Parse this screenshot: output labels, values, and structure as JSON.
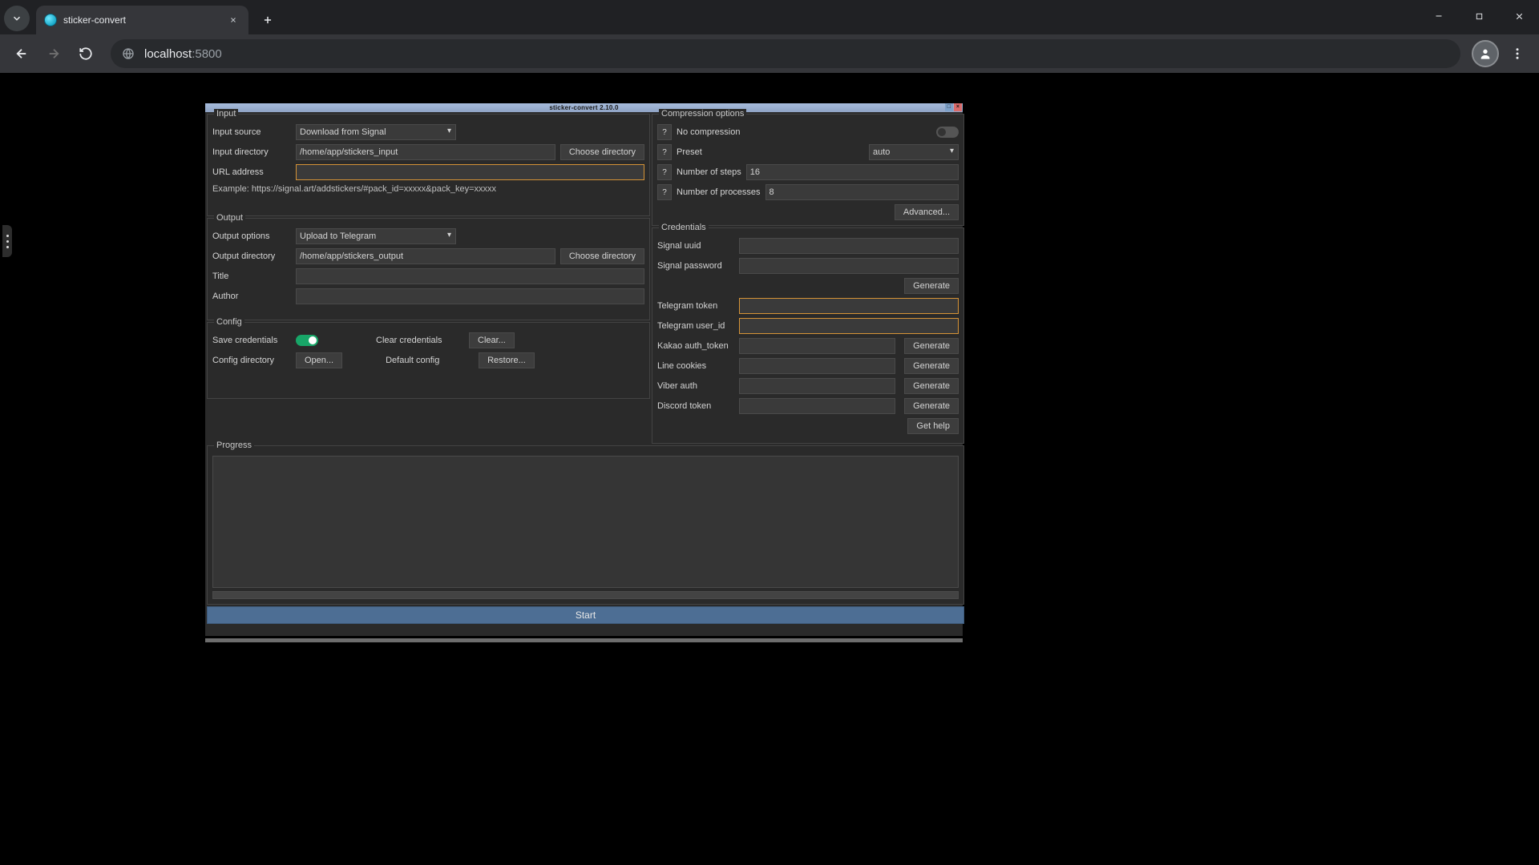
{
  "browser": {
    "tab_title": "sticker-convert",
    "url_host": "localhost",
    "url_port": ":5800"
  },
  "app": {
    "title": "sticker-convert 2.10.0",
    "input": {
      "legend": "Input",
      "source_label": "Input source",
      "source_value": "Download from Signal",
      "dir_label": "Input directory",
      "dir_value": "/home/app/stickers_input",
      "choose_btn": "Choose directory",
      "url_label": "URL address",
      "url_value": "",
      "example": "Example: https://signal.art/addstickers/#pack_id=xxxxx&pack_key=xxxxx"
    },
    "output": {
      "legend": "Output",
      "options_label": "Output options",
      "options_value": "Upload to Telegram",
      "dir_label": "Output directory",
      "dir_value": "/home/app/stickers_output",
      "choose_btn": "Choose directory",
      "title_label": "Title",
      "title_value": "",
      "author_label": "Author",
      "author_value": ""
    },
    "config": {
      "legend": "Config",
      "save_label": "Save credentials",
      "clear_label": "Clear credentials",
      "clear_btn": "Clear...",
      "dir_label": "Config directory",
      "open_btn": "Open...",
      "default_label": "Default config",
      "restore_btn": "Restore..."
    },
    "compression": {
      "legend": "Compression options",
      "nocomp_label": "No compression",
      "preset_label": "Preset",
      "preset_value": "auto",
      "steps_label": "Number of steps",
      "steps_value": "16",
      "procs_label": "Number of processes",
      "procs_value": "8",
      "advanced_btn": "Advanced..."
    },
    "credentials": {
      "legend": "Credentials",
      "signal_uuid": "Signal uuid",
      "signal_password": "Signal password",
      "generate_btn": "Generate",
      "telegram_token": "Telegram token",
      "telegram_userid": "Telegram user_id",
      "kakao_token": "Kakao auth_token",
      "line_cookies": "Line cookies",
      "viber_auth": "Viber auth",
      "discord_token": "Discord token",
      "get_help_btn": "Get help"
    },
    "progress": {
      "legend": "Progress"
    },
    "start_btn": "Start",
    "help_q": "?"
  }
}
